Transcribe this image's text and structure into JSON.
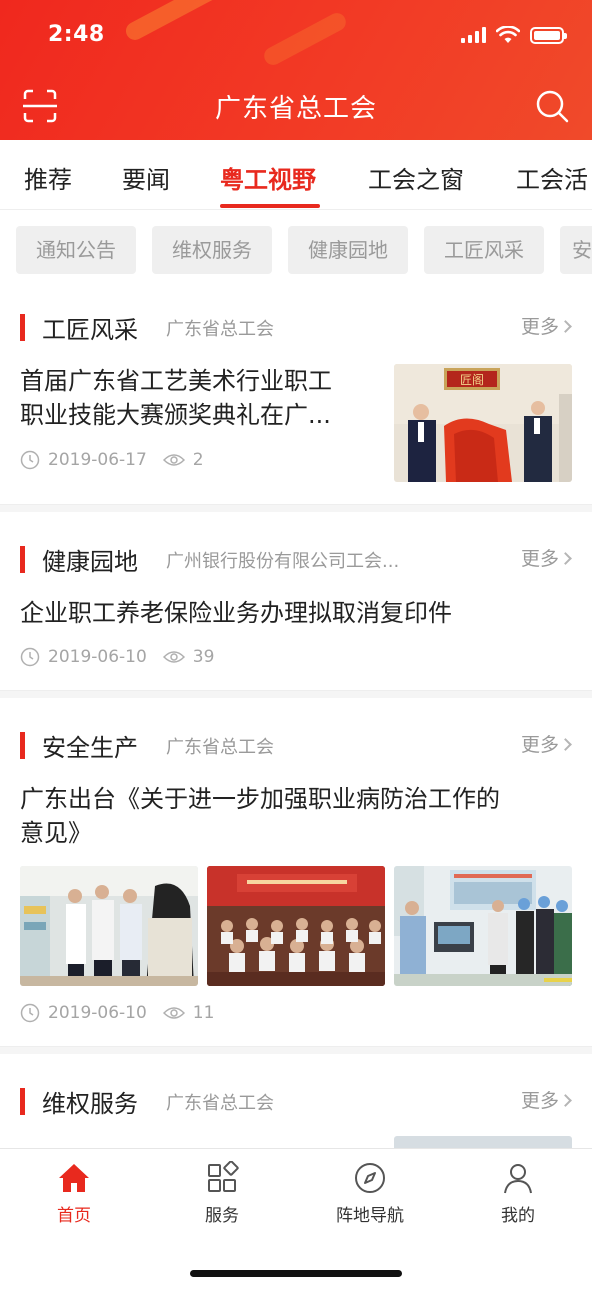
{
  "status": {
    "time": "2:48"
  },
  "header": {
    "title": "广东省总工会",
    "left_icon": "scan-icon",
    "right_icon": "search-icon"
  },
  "tabs": [
    {
      "label": "推荐",
      "active": false
    },
    {
      "label": "要闻",
      "active": false
    },
    {
      "label": "粤工视野",
      "active": true
    },
    {
      "label": "工会之窗",
      "active": false
    },
    {
      "label": "工会活",
      "active": false
    }
  ],
  "chips": [
    "通知公告",
    "维权服务",
    "健康园地",
    "工匠风采",
    "安"
  ],
  "sections": [
    {
      "name": "工匠风采",
      "source": "广东省总工会",
      "more": "更多",
      "article": {
        "title_line1": "首届广东省工艺美术行业职工",
        "title_line2": "职业技能大赛颁奖典礼在广...",
        "date": "2019-06-17",
        "views": "2",
        "thumb_sign": "匠阁"
      }
    },
    {
      "name": "健康园地",
      "source": "广州银行股份有限公司工会...",
      "more": "更多",
      "article": {
        "title_line1": "企业职工养老保险业务办理拟取消复印件",
        "date": "2019-06-10",
        "views": "39"
      }
    },
    {
      "name": "安全生产",
      "source": "广东省总工会",
      "more": "更多",
      "article": {
        "title_line1": "广东出台《关于进一步加强职业病防治工作的",
        "title_line2": "意见》",
        "date": "2019-06-10",
        "views": "11"
      }
    },
    {
      "name": "维权服务",
      "source": "广东省总工会",
      "more": "更多",
      "article": {
        "title_line1": ""
      }
    }
  ],
  "bottom_nav": [
    {
      "label": "首页",
      "icon": "home-icon",
      "active": true
    },
    {
      "label": "服务",
      "icon": "grid-icon",
      "active": false
    },
    {
      "label": "阵地导航",
      "icon": "compass-icon",
      "active": false
    },
    {
      "label": "我的",
      "icon": "person-icon",
      "active": false
    }
  ],
  "colors": {
    "primary": "#e8291e",
    "muted": "#9a9a9a"
  }
}
